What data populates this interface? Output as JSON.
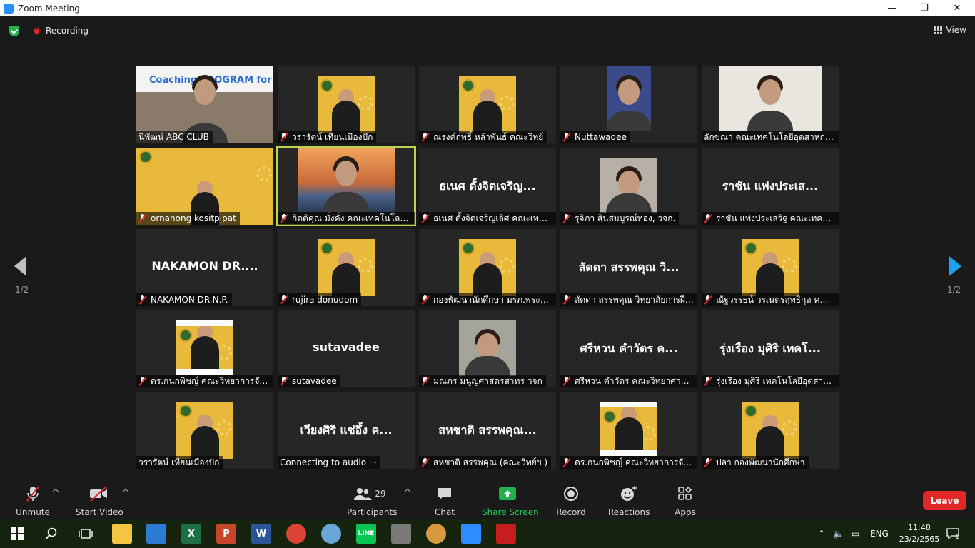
{
  "window": {
    "title": "Zoom Meeting",
    "controls": {
      "minimize": "—",
      "maximize": "❐",
      "close": "✕"
    }
  },
  "topbar": {
    "recording_label": "Recording",
    "view_label": "View"
  },
  "pager": {
    "left": "1/2",
    "right": "1/2"
  },
  "tiles": [
    {
      "name": "นิพัฒน์ ABC CLUB",
      "center": "",
      "kind": "photo",
      "bg": "#8a7a6a",
      "banner": "Coaching PROGRAM for Teacher",
      "muted": false
    },
    {
      "name": "วรารัตน์ เทียนเมืองปัก",
      "center": "",
      "kind": "poster",
      "muted": true
    },
    {
      "name": "ณรงค์ฤทธิ์ หล้าพันธ์ คณะวิทย์",
      "center": "",
      "kind": "poster",
      "muted": true
    },
    {
      "name": "Nuttawadee",
      "center": "",
      "kind": "photo",
      "bg": "#3b4a8a",
      "muted": true
    },
    {
      "name": "ลักขณา คณะเทคโนโลยีอุตสาหกรรม",
      "center": "",
      "kind": "photo",
      "bg": "#e9e6df",
      "muted": false
    },
    {
      "name": "ornanong kositpipat",
      "center": "",
      "kind": "poster-wide",
      "muted": true
    },
    {
      "name": "กิตติคุณ มั่งคั่ง คณะเทคโนโลยีอุตสาห...",
      "center": "",
      "kind": "photo",
      "bg": "#c98b54",
      "muted": true,
      "active": true
    },
    {
      "name": "ธเนศ ตั้งจิตเจริญเลิศ คณะเทคโนโ...",
      "center": "ธเนศ ตั้งจิตเจริญ...",
      "kind": "name",
      "muted": true
    },
    {
      "name": "รุจิภา สินสมบูรณ์ทอง, วจก.",
      "center": "",
      "kind": "photo",
      "bg": "#b8b0a6",
      "muted": true
    },
    {
      "name": "ราชัน แพ่งประเสริฐ คณะเทคโนโล...",
      "center": "ราชัน แพ่งประเส...",
      "kind": "name",
      "muted": true
    },
    {
      "name": "NAKAMON DR.N.P.",
      "center": "NAKAMON DR....",
      "kind": "name",
      "muted": true
    },
    {
      "name": "rujira donudom",
      "center": "",
      "kind": "poster",
      "muted": true
    },
    {
      "name": "กองพัฒนานักศึกษา มรภ.พระนคร",
      "center": "",
      "kind": "poster",
      "muted": true
    },
    {
      "name": "ลัดดา สรรพคุณ วิทยาลัยการฝึก...",
      "center": "ลัดดา สรรพคุณ วิ...",
      "kind": "name",
      "muted": true
    },
    {
      "name": "ณัฐวรรธน์ วรเนตรสุทธิกุล คณะ...",
      "center": "",
      "kind": "poster",
      "muted": true
    },
    {
      "name": "ดร.กนกพิชญ์ คณะวิทยาการจัด...",
      "center": "",
      "kind": "poster-white",
      "muted": true
    },
    {
      "name": "sutavadee",
      "center": "sutavadee",
      "kind": "name",
      "muted": true
    },
    {
      "name": "มณภร มนูญศาสตรสาทร วจก",
      "center": "",
      "kind": "photo",
      "bg": "#a4a49a",
      "muted": true
    },
    {
      "name": "ศรีหวน  คำวัตร คณะวิทยาศาสต...",
      "center": "ศรีหวน  คำวัตร ค...",
      "kind": "name",
      "muted": true
    },
    {
      "name": "รุ่งเรือง มุศิริ เทคโนโลยีอุตสาหกร...",
      "center": "รุ่งเรือง มุศิริ เทคโ...",
      "kind": "name",
      "muted": true
    },
    {
      "name": "วรารัตน์ เทียนเมืองปัก",
      "center": "",
      "kind": "poster",
      "muted": false
    },
    {
      "name": "Connecting to audio ···",
      "center": "เวียงศิริ แช่อึ้ง ค...",
      "kind": "name",
      "muted": false
    },
    {
      "name": "สหชาติ สรรพคุณ (คณะวิทย์ฯ )",
      "center": "สหชาติ สรรพคุณ...",
      "kind": "name",
      "muted": true
    },
    {
      "name": "ดร.กนกพิชญ์ คณะวิทยาการจัด...",
      "center": "",
      "kind": "poster-white",
      "muted": true
    },
    {
      "name": "ปลา กองพัฒนานักศึกษา",
      "center": "",
      "kind": "poster",
      "muted": true
    }
  ],
  "toolbar": {
    "unmute": "Unmute",
    "start_video": "Start Video",
    "participants": "Participants",
    "participant_count": "29",
    "chat": "Chat",
    "share_screen": "Share Screen",
    "record": "Record",
    "reactions": "Reactions",
    "apps": "Apps",
    "leave": "Leave"
  },
  "taskbar": {
    "lang": "ENG",
    "time": "11:48",
    "date": "23/2/2565",
    "notifications": "1"
  },
  "colors": {
    "accent_green": "#23b14d",
    "leave_red": "#e02828",
    "active_outline": "#b9d64e",
    "nav_blue": "#1ea0f1"
  }
}
